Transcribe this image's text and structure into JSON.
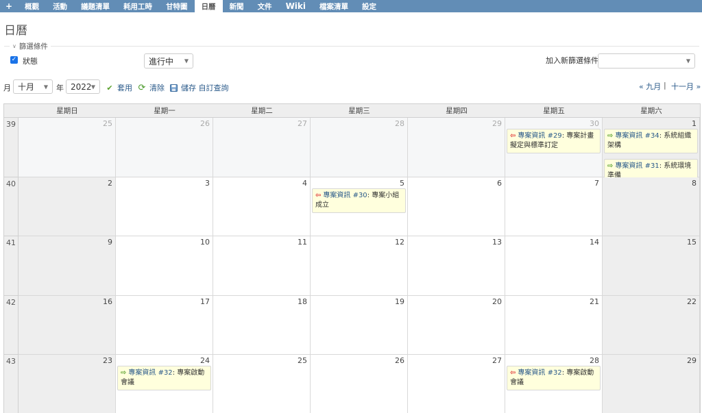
{
  "topbar": {
    "plus": "+",
    "tabs": [
      "概觀",
      "活動",
      "議題清單",
      "耗用工時",
      "甘特圖",
      "日曆",
      "新聞",
      "文件",
      "Wiki",
      "檔案清單",
      "設定"
    ],
    "selected": "日曆"
  },
  "page_title": "日曆",
  "filters": {
    "legend": "篩選條件",
    "status_label": "狀態",
    "status_checked": true,
    "status_operator": "進行中",
    "add_filter_label": "加入新篩選條件",
    "add_filter_value": ""
  },
  "toolbar": {
    "month_label": "月",
    "month_value": "十月",
    "year_label": "年",
    "year_value": "2022",
    "apply": "套用",
    "clear": "清除",
    "save": "儲存 自訂查詢",
    "prev": "« 九月",
    "sep": "|",
    "next": "十一月 »"
  },
  "calendar": {
    "day_names": [
      "星期日",
      "星期一",
      "星期二",
      "星期三",
      "星期四",
      "星期五",
      "星期六"
    ],
    "weeks": [
      {
        "week": "39",
        "days": [
          "25",
          "26",
          "27",
          "28",
          "29",
          "30",
          "1"
        ],
        "other": [
          true,
          true,
          true,
          true,
          true,
          true,
          false
        ]
      },
      {
        "week": "40",
        "days": [
          "2",
          "3",
          "4",
          "5",
          "6",
          "7",
          "8"
        ],
        "other": [
          false,
          false,
          false,
          false,
          false,
          false,
          false
        ]
      },
      {
        "week": "41",
        "days": [
          "9",
          "10",
          "11",
          "12",
          "13",
          "14",
          "15"
        ],
        "other": [
          false,
          false,
          false,
          false,
          false,
          false,
          false
        ]
      },
      {
        "week": "42",
        "days": [
          "16",
          "17",
          "18",
          "19",
          "20",
          "21",
          "22"
        ],
        "other": [
          false,
          false,
          false,
          false,
          false,
          false,
          false
        ]
      },
      {
        "week": "43",
        "days": [
          "23",
          "24",
          "25",
          "26",
          "27",
          "28",
          "29"
        ],
        "other": [
          false,
          false,
          false,
          false,
          false,
          false,
          false
        ]
      }
    ],
    "issues": [
      {
        "week": 0,
        "day": 5,
        "slot": 0,
        "kind": "start",
        "link": "專案資訊 #29",
        "text": ": 專案計畫擬定與標準訂定"
      },
      {
        "week": 0,
        "day": 6,
        "slot": 0,
        "kind": "end",
        "link": "專案資訊 #34",
        "text": ": 系統組織架構"
      },
      {
        "week": 0,
        "day": 6,
        "slot": 1,
        "kind": "end",
        "link": "專案資訊 #31",
        "text": ": 系統環境準備"
      },
      {
        "week": 1,
        "day": 3,
        "slot": 0,
        "kind": "start",
        "link": "專案資訊 #30",
        "text": ": 專案小組成立"
      },
      {
        "week": 4,
        "day": 1,
        "slot": 0,
        "kind": "end",
        "link": "專案資訊 #32",
        "text": ": 專案啟動會議"
      },
      {
        "week": 4,
        "day": 5,
        "slot": 0,
        "kind": "start",
        "link": "專案資訊 #32",
        "text": ": 專案啟動會議"
      }
    ]
  }
}
